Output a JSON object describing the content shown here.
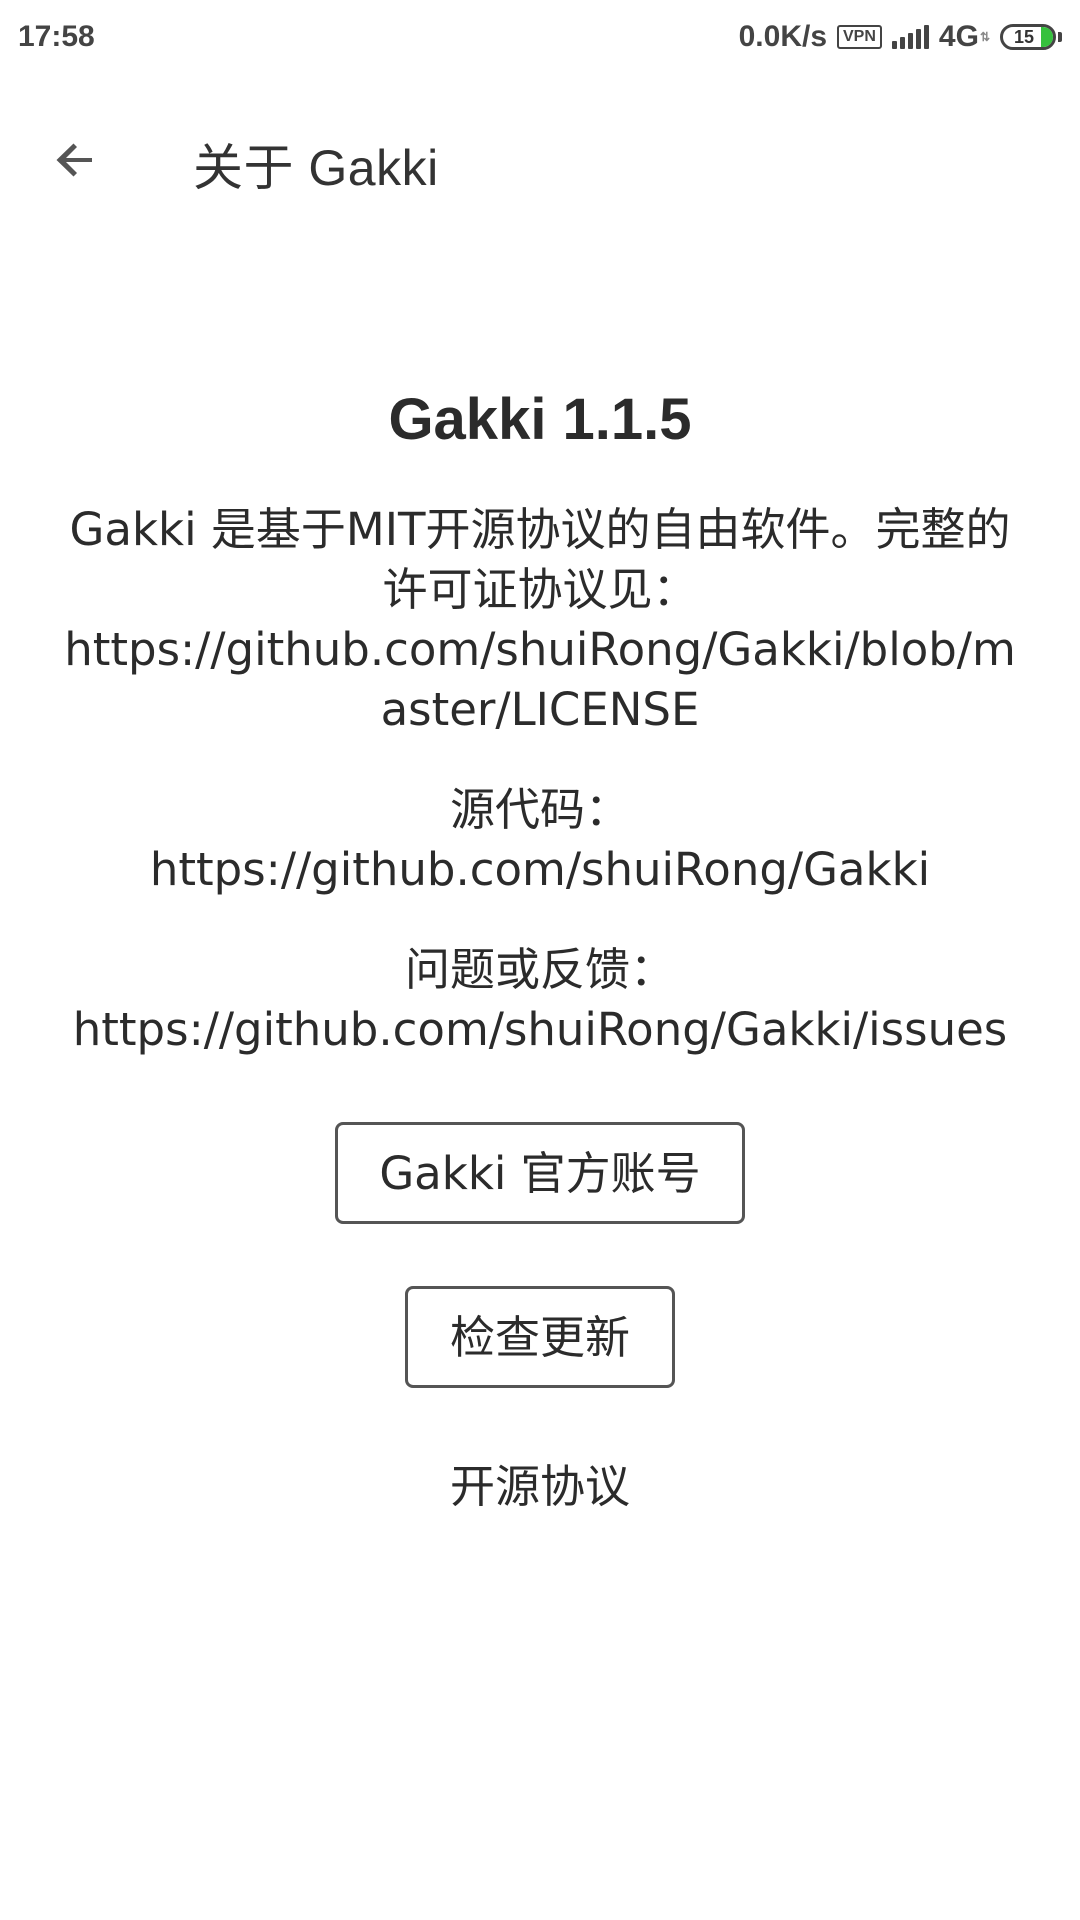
{
  "status_bar": {
    "time": "17:58",
    "net_speed": "0.0K/s",
    "vpn_label": "VPN",
    "network_type": "4G",
    "battery_level": "15"
  },
  "toolbar": {
    "title": "关于 Gakki",
    "back_icon": "arrow-left-icon"
  },
  "about": {
    "app_version": "Gakki 1.1.5",
    "license_text": "Gakki 是基于MIT开源协议的自由软件。完整的许可证协议见：",
    "license_url": "https://github.com/shuiRong/Gakki/blob/master/LICENSE",
    "source_label": "源代码：",
    "source_url": "https://github.com/shuiRong/Gakki",
    "issues_label": "问题或反馈：",
    "issues_url": "https://github.com/shuiRong/Gakki/issues"
  },
  "actions": {
    "official_account_label": "Gakki 官方账号",
    "check_update_label": "检查更新",
    "open_source_license_label": "开源协议"
  }
}
